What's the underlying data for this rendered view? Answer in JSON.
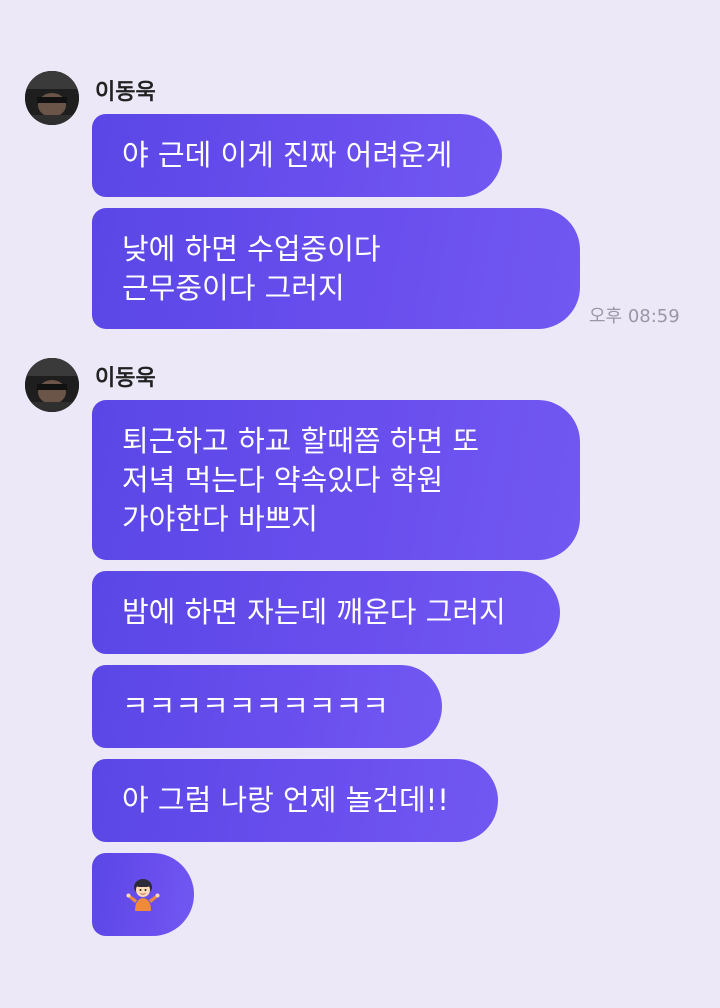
{
  "colors": {
    "background": "#ece8f8",
    "bubble": "#6a4fee",
    "bubble_text": "#ffffff",
    "timestamp": "#9a97a8"
  },
  "groups": [
    {
      "sender": "이동욱",
      "avatar_icon": "profile-photo-icon",
      "messages": [
        {
          "lines": [
            "야 근데 이게 진짜 어려운게"
          ]
        },
        {
          "lines": [
            "낮에 하면 수업중이다",
            "근무중이다 그러지"
          ]
        }
      ],
      "time": "오후 08:59"
    },
    {
      "sender": "이동욱",
      "avatar_icon": "profile-photo-icon",
      "messages": [
        {
          "lines": [
            "퇴근하고 하교 할때쯤 하면 또",
            "저녁 먹는다 약속있다 학원",
            "가야한다 바쁘지"
          ]
        },
        {
          "lines": [
            "밤에 하면 자는데 깨운다 그러지"
          ]
        },
        {
          "lines": [
            "ㅋㅋㅋㅋㅋㅋㅋㅋㅋㅋ"
          ]
        },
        {
          "lines": [
            "아 그럼 나랑 언제 놀건데!!"
          ]
        },
        {
          "emoji": "shrugging-person-emoji"
        }
      ]
    }
  ]
}
